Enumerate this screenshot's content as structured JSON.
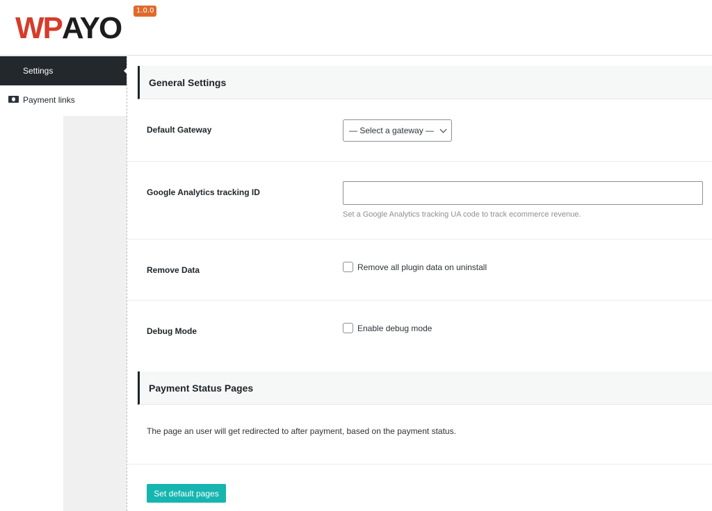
{
  "app": {
    "logo_wp": "WP",
    "logo_payo": "AYO",
    "version": "1.0.0"
  },
  "sidebar": {
    "items": [
      {
        "label": "Settings",
        "active": true
      },
      {
        "label": "Payment links",
        "icon": "money-icon"
      }
    ]
  },
  "general": {
    "title": "General Settings",
    "default_gateway": {
      "label": "Default Gateway",
      "selected": "— Select a gateway —"
    },
    "ga": {
      "label": "Google Analytics tracking ID",
      "value": "",
      "hint": "Set a Google Analytics tracking UA code to track ecommerce revenue."
    },
    "remove_data": {
      "label": "Remove Data",
      "checkbox_label": "Remove all plugin data on uninstall",
      "checked": false
    },
    "debug": {
      "label": "Debug Mode",
      "checkbox_label": "Enable debug mode",
      "checked": false
    }
  },
  "status_pages": {
    "title": "Payment Status Pages",
    "description": "The page an user will get redirected to after payment, based on the payment status.",
    "button_label": "Set default pages"
  },
  "colors": {
    "accent": "#16b5b0",
    "sidebar_active": "#23282d",
    "brand_red": "#d63c2a",
    "badge": "#e06a2b"
  }
}
